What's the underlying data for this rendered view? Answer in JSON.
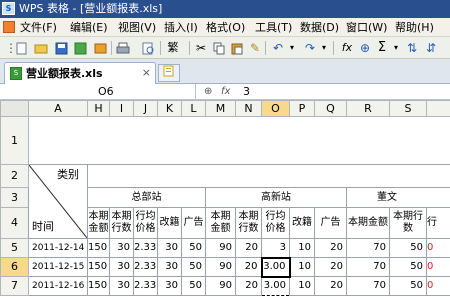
{
  "window": {
    "title": "WPS 表格 - [营业额报表.xls]"
  },
  "menu": [
    "文件(F)",
    "编辑(E)",
    "视图(V)",
    "插入(I)",
    "格式(O)",
    "工具(T)",
    "数据(D)",
    "窗口(W)",
    "帮助(H)"
  ],
  "tab": {
    "label": "营业额报表.xls",
    "close": "×"
  },
  "name_box": "O6",
  "formula_value": "3",
  "columns": [
    "A",
    "H",
    "I",
    "J",
    "K",
    "L",
    "M",
    "N",
    "O",
    "P",
    "Q",
    "R",
    "S",
    ""
  ],
  "rows": [
    "1",
    "2",
    "3",
    "4",
    "5",
    "6",
    "7"
  ],
  "header": {
    "category": "类别",
    "time": "时间",
    "groups": [
      "总部站",
      "高新站",
      "董文"
    ],
    "sub": [
      "本期金额",
      "本期行数",
      "行均价格",
      "改籍",
      "广告",
      "本期金额",
      "本期行数",
      "行均价格",
      "改籍",
      "广告",
      "本期金额",
      "本期行数",
      "行"
    ]
  },
  "data_rows": [
    {
      "date": "2011-12-14",
      "cells": [
        "150",
        "30",
        "2.33",
        "30",
        "50",
        "90",
        "20",
        "3",
        "10",
        "20",
        "70",
        "50",
        "0"
      ]
    },
    {
      "date": "2011-12-15",
      "cells": [
        "150",
        "30",
        "2.33",
        "30",
        "50",
        "90",
        "20",
        "3.00",
        "10",
        "20",
        "70",
        "50",
        "0"
      ]
    },
    {
      "date": "2011-12-16",
      "cells": [
        "150",
        "30",
        "2.33",
        "30",
        "50",
        "90",
        "20",
        "3.00",
        "10",
        "20",
        "70",
        "50",
        "0"
      ]
    }
  ],
  "toolbar": {
    "icons": [
      "new-icon",
      "open-icon",
      "save-icon",
      "export-icon",
      "print-icon",
      "print-preview-icon",
      "spellcheck-icon",
      "cut-icon",
      "copy-icon",
      "paste-icon",
      "format-painter-icon",
      "undo-icon",
      "redo-icon",
      "function-icon",
      "sum-icon",
      "sort-icon"
    ],
    "sum_glyph": "Σ",
    "fx_glyph": "fx"
  }
}
